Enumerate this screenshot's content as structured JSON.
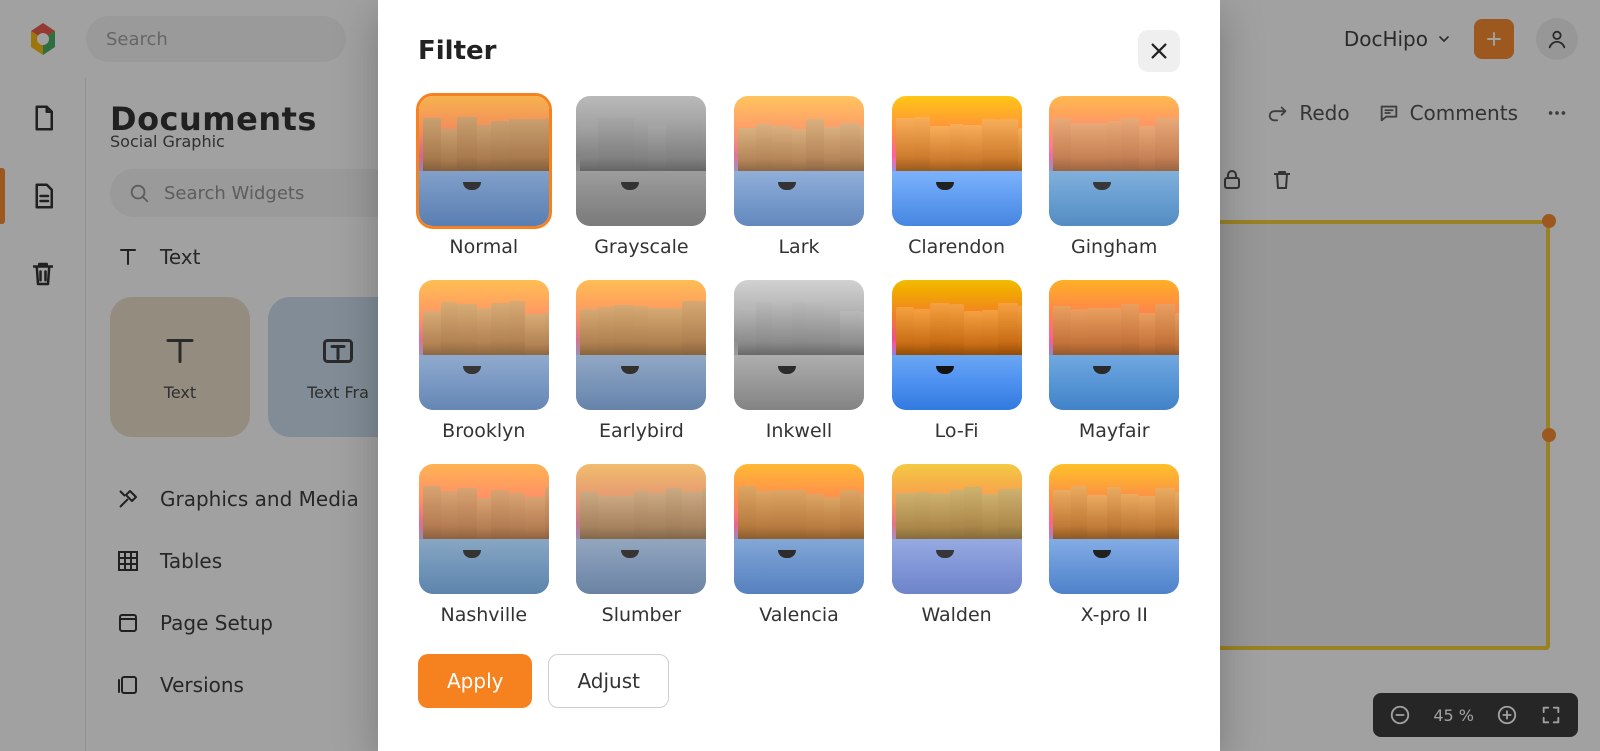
{
  "topbar": {
    "search_placeholder": "Search",
    "brand_label": "DocHipo"
  },
  "canvas_toolbar": {
    "redo_label": "Redo",
    "comments_label": "Comments"
  },
  "sidepanel": {
    "title": "Documents",
    "subtitle": "Social Graphic",
    "widget_search_placeholder": "Search Widgets",
    "text_label": "Text",
    "cards": {
      "text_label": "Text",
      "textframe_label": "Text Fra"
    },
    "items": {
      "graphics_label": "Graphics and Media",
      "tables_label": "Tables",
      "pagesetup_label": "Page Setup",
      "versions_label": "Versions"
    }
  },
  "dialog": {
    "title": "Filter",
    "apply_label": "Apply",
    "adjust_label": "Adjust",
    "selected": "Normal",
    "filters": [
      {
        "id": "normal",
        "label": "Normal"
      },
      {
        "id": "grayscale",
        "label": "Grayscale"
      },
      {
        "id": "lark",
        "label": "Lark"
      },
      {
        "id": "clarendon",
        "label": "Clarendon"
      },
      {
        "id": "gingham",
        "label": "Gingham"
      },
      {
        "id": "brooklyn",
        "label": "Brooklyn"
      },
      {
        "id": "earlybird",
        "label": "Earlybird"
      },
      {
        "id": "inkwell",
        "label": "Inkwell"
      },
      {
        "id": "lofi",
        "label": "Lo-Fi"
      },
      {
        "id": "mayfair",
        "label": "Mayfair"
      },
      {
        "id": "nashville",
        "label": "Nashville"
      },
      {
        "id": "slumber",
        "label": "Slumber"
      },
      {
        "id": "valencia",
        "label": "Valencia"
      },
      {
        "id": "walden",
        "label": "Walden"
      },
      {
        "id": "xproii",
        "label": "X-pro II"
      }
    ]
  },
  "zoom": {
    "value": "45",
    "unit": "%"
  }
}
